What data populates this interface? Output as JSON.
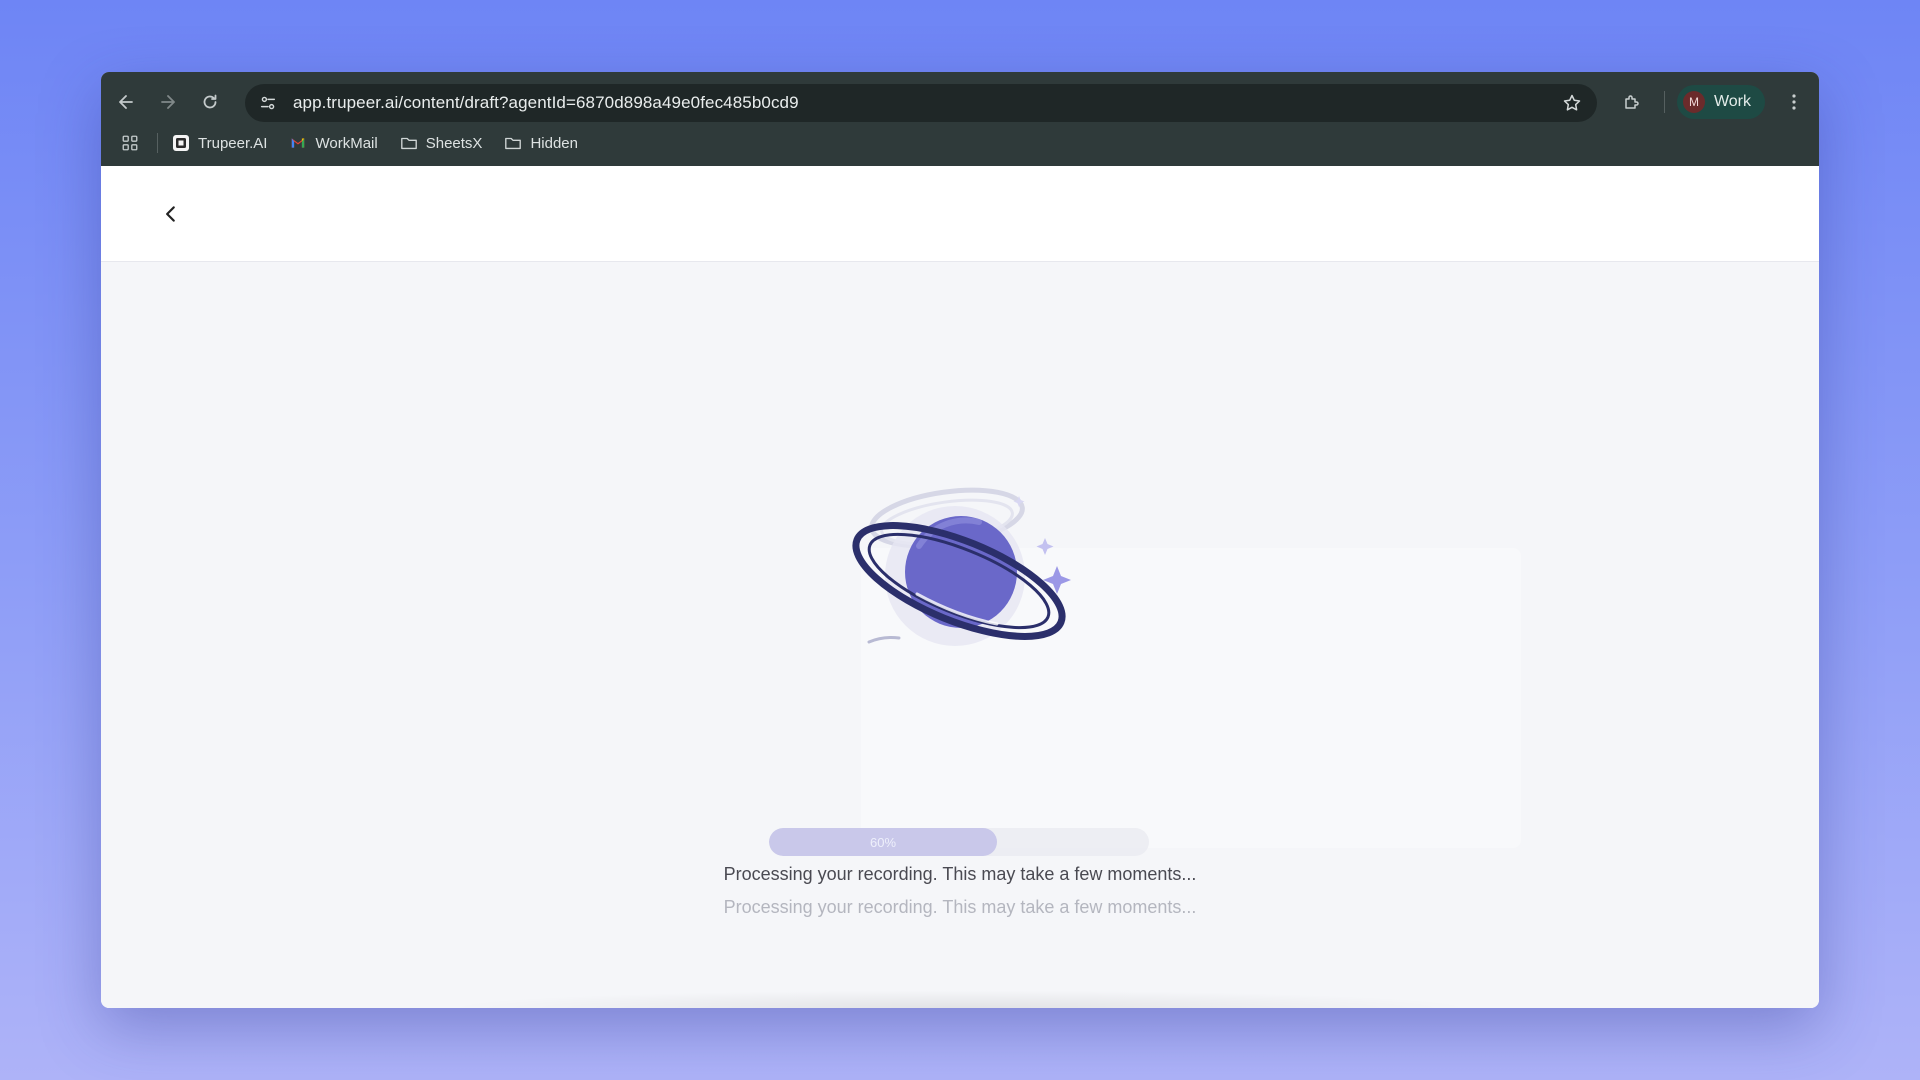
{
  "browser": {
    "url": "app.trupeer.ai/content/draft?agentId=6870d898a49e0fec485b0cd9",
    "profile": {
      "initial": "M",
      "label": "Work",
      "avatar_color": "#6b2b2b"
    },
    "bookmarks": [
      {
        "label": "Trupeer.AI",
        "icon": "trupeer-logo-icon"
      },
      {
        "label": "WorkMail",
        "icon": "gmail-icon"
      },
      {
        "label": "SheetsX",
        "icon": "folder-icon"
      },
      {
        "label": "Hidden",
        "icon": "folder-icon"
      }
    ]
  },
  "page": {
    "progress": {
      "value": 60,
      "label": "60%"
    },
    "status_text": "Processing your recording. This may take a few moments...",
    "status_text_faded": "Processing your recording. This may take a few moments...",
    "illustration": "planet-illustration",
    "accent_color": "#5b5fc7"
  }
}
